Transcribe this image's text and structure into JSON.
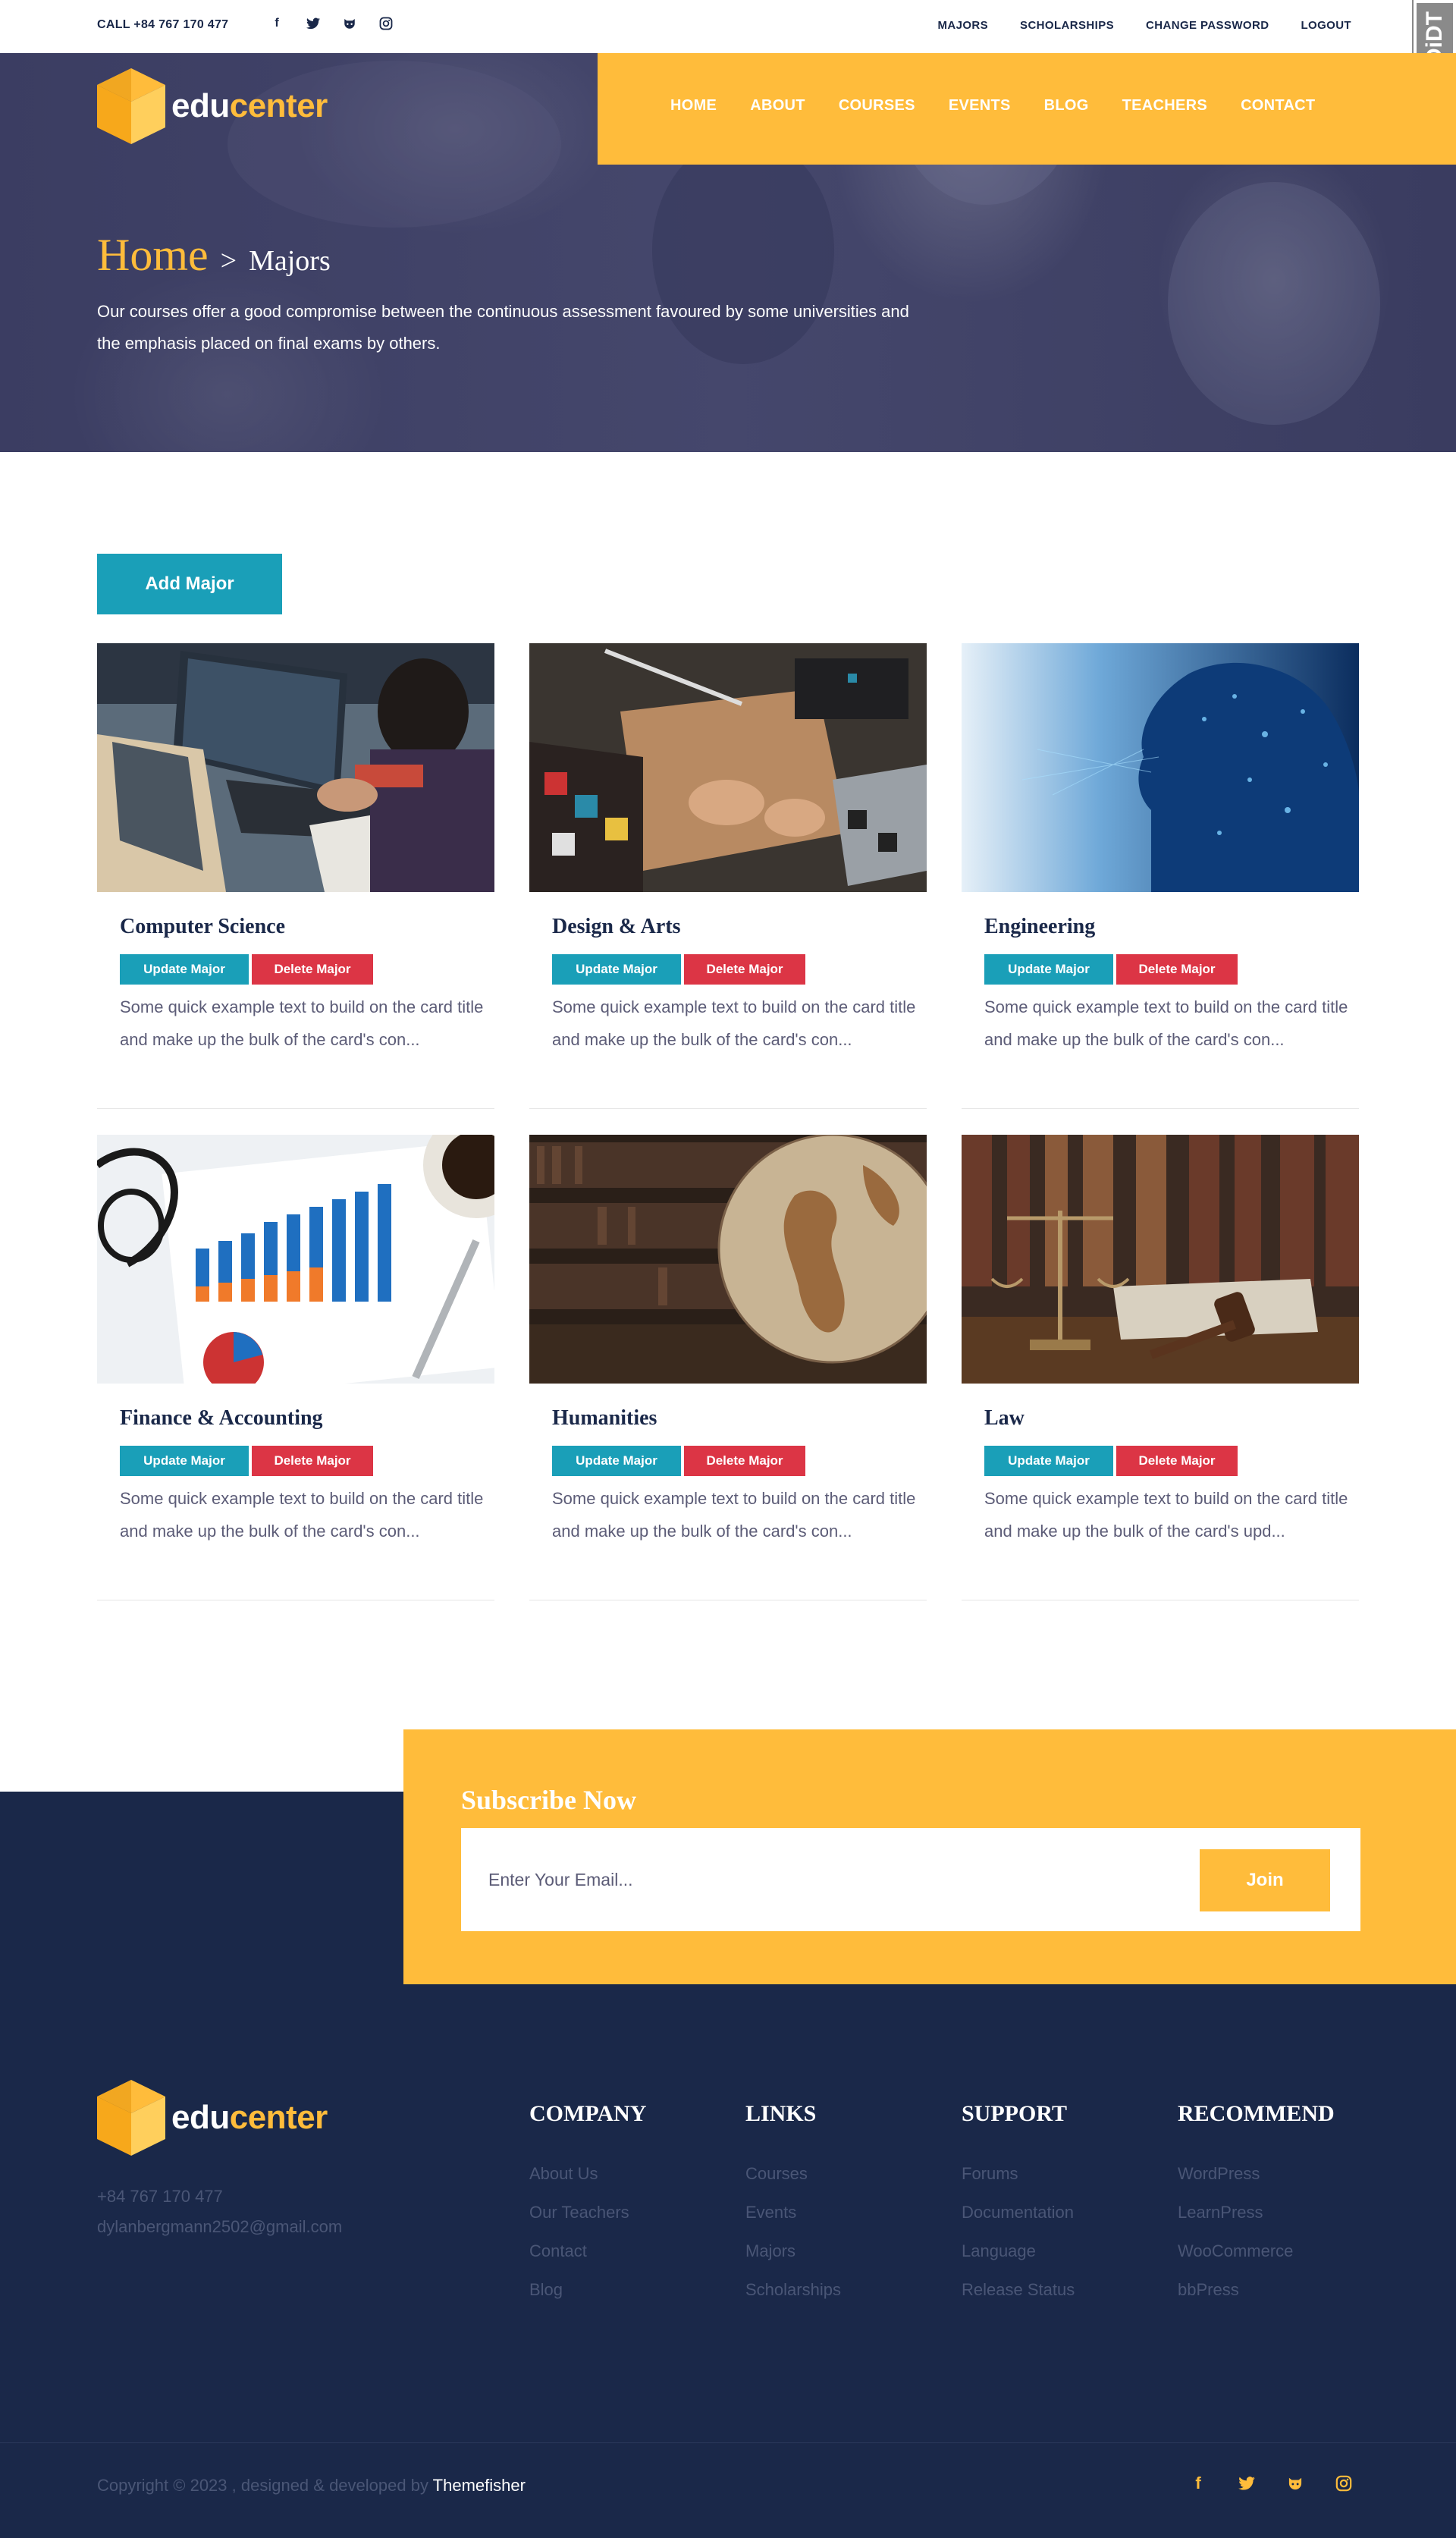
{
  "topbar": {
    "call": "CALL +84 767 170 477",
    "social_icons": [
      "facebook-icon",
      "twitter-icon",
      "github-icon",
      "instagram-icon"
    ],
    "links": [
      "MAJORS",
      "SCHOLARSHIPS",
      "CHANGE PASSWORD",
      "LOGOUT"
    ],
    "badge": "DiDT"
  },
  "brand": {
    "edu": "edu",
    "center": "center"
  },
  "nav": {
    "items": [
      "HOME",
      "ABOUT",
      "COURSES",
      "EVENTS",
      "BLOG",
      "TEACHERS",
      "CONTACT"
    ]
  },
  "hero": {
    "breadcrumb_home": "Home",
    "breadcrumb_sep": ">",
    "breadcrumb_current": "Majors",
    "description": "Our courses offer a good compromise between the continuous assessment favoured by some universities and the emphasis placed on final exams by others."
  },
  "majors": {
    "add_label": "Add Major",
    "update_label": "Update Major",
    "delete_label": "Delete Major",
    "cards": [
      {
        "title": "Computer Science",
        "description": "Some quick example text to build on the card title and make up the bulk of the card's con..."
      },
      {
        "title": "Design & Arts",
        "description": "Some quick example text to build on the card title and make up the bulk of the card's con..."
      },
      {
        "title": "Engineering",
        "description": "Some quick example text to build on the card title and make up the bulk of the card's con..."
      },
      {
        "title": "Finance & Accounting",
        "description": "Some quick example text to build on the card title and make up the bulk of the card's con..."
      },
      {
        "title": "Humanities",
        "description": "Some quick example text to build on the card title and make up the bulk of the card's con..."
      },
      {
        "title": "Law",
        "description": "Some quick example text to build on the card title and make up the bulk of the card's upd..."
      }
    ]
  },
  "subscribe": {
    "title": "Subscribe Now",
    "placeholder": "Enter Your Email...",
    "join_label": "Join"
  },
  "footer": {
    "phone": "+84 767 170 477",
    "email": "dylanbergmann2502@gmail.com",
    "columns": [
      {
        "title": "COMPANY",
        "items": [
          "About Us",
          "Our Teachers",
          "Contact",
          "Blog"
        ]
      },
      {
        "title": "LINKS",
        "items": [
          "Courses",
          "Events",
          "Majors",
          "Scholarships"
        ]
      },
      {
        "title": "SUPPORT",
        "items": [
          "Forums",
          "Documentation",
          "Language",
          "Release Status"
        ]
      },
      {
        "title": "RECOMMEND",
        "items": [
          "WordPress",
          "LearnPress",
          "WooCommerce",
          "bbPress"
        ]
      }
    ],
    "copyright_prefix": "Copyright © 2023 , designed & developed by",
    "copyright_brand": "Themefisher",
    "social_icons": [
      "facebook-icon",
      "twitter-icon",
      "github-icon",
      "instagram-icon"
    ]
  },
  "colors": {
    "accent": "#ffbc3b",
    "teal": "#1a9fb8",
    "danger": "#dc3545",
    "navy": "#1a2849"
  }
}
